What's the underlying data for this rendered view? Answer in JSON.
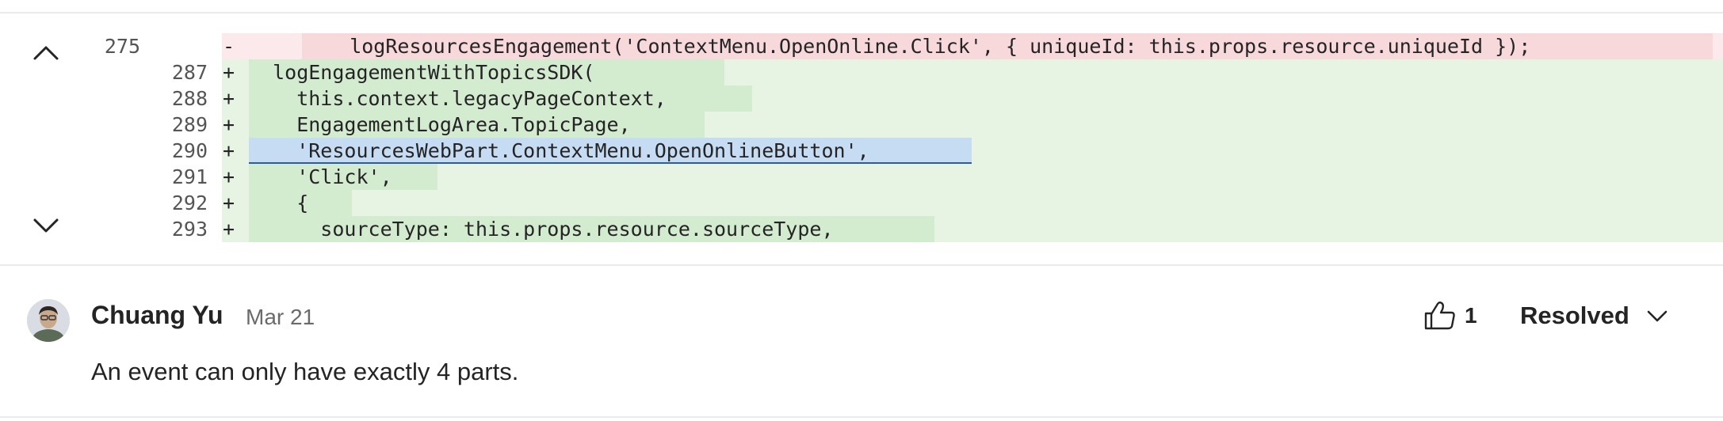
{
  "diff": {
    "lines": [
      {
        "type": "del",
        "old": "275",
        "new": "",
        "sign": "-",
        "code": "    logResourcesEngagement('ContextMenu.OpenOnline.Click', { uniqueId: this.props.resource.uniqueId });"
      },
      {
        "type": "add",
        "old": "",
        "new": "287",
        "sign": "+",
        "code": "  logEngagementWithTopicsSDK("
      },
      {
        "type": "add",
        "old": "",
        "new": "288",
        "sign": "+",
        "code": "    this.context.legacyPageContext,"
      },
      {
        "type": "add",
        "old": "",
        "new": "289",
        "sign": "+",
        "code": "    EngagementLogArea.TopicPage,"
      },
      {
        "type": "sel",
        "old": "",
        "new": "290",
        "sign": "+",
        "code": "    'ResourcesWebPart.ContextMenu.OpenOnlineButton',"
      },
      {
        "type": "add",
        "old": "",
        "new": "291",
        "sign": "+",
        "code": "    'Click',"
      },
      {
        "type": "add",
        "old": "",
        "new": "292",
        "sign": "+",
        "code": "    {"
      },
      {
        "type": "add",
        "old": "",
        "new": "293",
        "sign": "+",
        "code": "      sourceType: this.props.resource.sourceType,"
      }
    ]
  },
  "comment": {
    "author": "Chuang Yu",
    "date": "Mar 21",
    "text": "An event can only have exactly 4 parts.",
    "likes": "1",
    "status": "Resolved"
  },
  "icons": {
    "scroll_up": "chevron-up-icon",
    "scroll_down": "chevron-down-icon",
    "like": "thumbs-up-icon",
    "status_menu": "chevron-down-icon"
  }
}
